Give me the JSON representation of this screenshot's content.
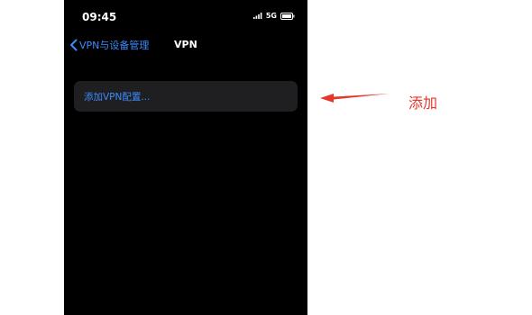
{
  "status_bar": {
    "time": "09:45",
    "network": "5G"
  },
  "nav": {
    "back_label": "VPN与设备管理",
    "title": "VPN"
  },
  "vpn": {
    "add_config_label": "添加VPN配置..."
  },
  "annotation": {
    "label": "添加",
    "color": "#e8352a"
  },
  "colors": {
    "accent": "#3d8bfd",
    "background": "#000000",
    "row_background": "#1f1f21"
  }
}
